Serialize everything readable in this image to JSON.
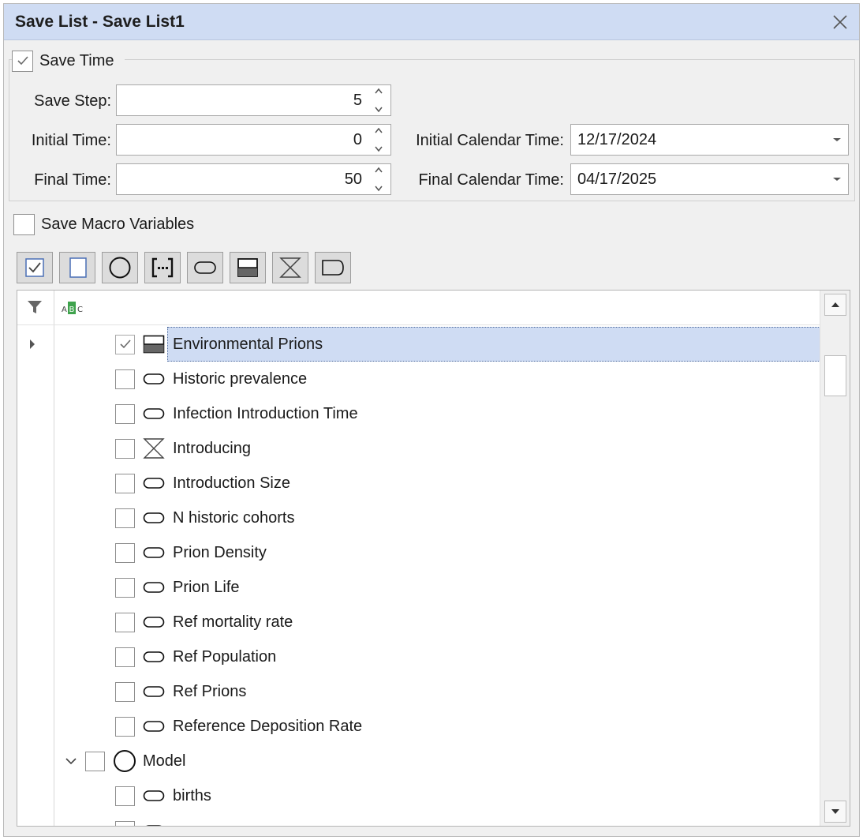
{
  "window": {
    "title": "Save List - Save List1"
  },
  "save_time": {
    "label": "Save Time",
    "checked": true,
    "save_step_label": "Save Step:",
    "save_step_value": "5",
    "initial_time_label": "Initial Time:",
    "initial_time_value": "0",
    "final_time_label": "Final Time:",
    "final_time_value": "50",
    "initial_calendar_label": "Initial Calendar Time:",
    "initial_calendar_value": "12/17/2024",
    "final_calendar_label": "Final Calendar Time:",
    "final_calendar_value": "04/17/2025"
  },
  "macro": {
    "label": "Save Macro Variables",
    "checked": false
  },
  "toolbar": {
    "buttons": [
      "check-all",
      "uncheck-all",
      "module-filter",
      "array-filter",
      "variable-filter",
      "stock-filter",
      "flow-filter",
      "connector-filter"
    ]
  },
  "tree": {
    "rows": [
      {
        "label": "Environmental Prions",
        "icon": "stock-icon",
        "checked": true,
        "selected": true
      },
      {
        "label": "Historic prevalence",
        "icon": "variable-icon",
        "checked": false
      },
      {
        "label": "Infection Introduction Time",
        "icon": "variable-icon",
        "checked": false
      },
      {
        "label": "Introducing",
        "icon": "flow-icon",
        "checked": false
      },
      {
        "label": "Introduction Size",
        "icon": "variable-icon",
        "checked": false
      },
      {
        "label": "N historic cohorts",
        "icon": "variable-icon",
        "checked": false
      },
      {
        "label": "Prion Density",
        "icon": "variable-icon",
        "checked": false
      },
      {
        "label": "Prion Life",
        "icon": "variable-icon",
        "checked": false
      },
      {
        "label": "Ref mortality rate",
        "icon": "variable-icon",
        "checked": false
      },
      {
        "label": "Ref Population",
        "icon": "variable-icon",
        "checked": false
      },
      {
        "label": "Ref Prions",
        "icon": "variable-icon",
        "checked": false
      },
      {
        "label": "Reference Deposition Rate",
        "icon": "variable-icon",
        "checked": false
      }
    ],
    "module": {
      "label": "Model",
      "icon": "module-icon",
      "checked": false,
      "expanded": true
    },
    "module_rows": [
      {
        "label": "births",
        "icon": "variable-icon",
        "checked": false
      }
    ]
  }
}
